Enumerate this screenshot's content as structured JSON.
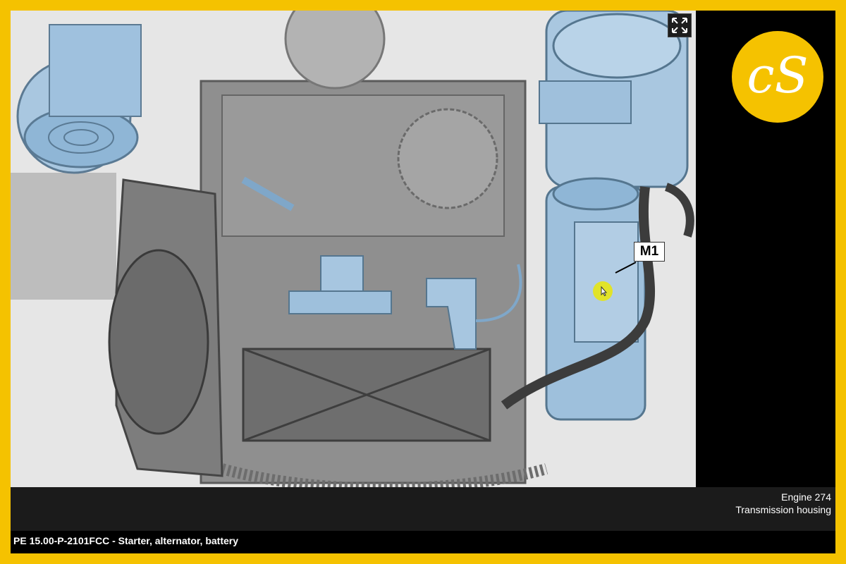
{
  "diagram": {
    "callout_label": "M1",
    "expand_icon": "expand-arrows-icon",
    "cursor_icon": "mouse-pointer-icon"
  },
  "caption": {
    "line1": "Engine 274",
    "line2": "Transmission housing"
  },
  "document": {
    "title": "PE 15.00-P-2101FCC - Starter, alternator, battery"
  },
  "logo": {
    "text": "cS"
  },
  "colors": {
    "frame": "#f5c200",
    "component_highlight": "#8fb6d6",
    "engine_gray": "#8a8a8a",
    "caption_bg": "#1b1b1b"
  }
}
